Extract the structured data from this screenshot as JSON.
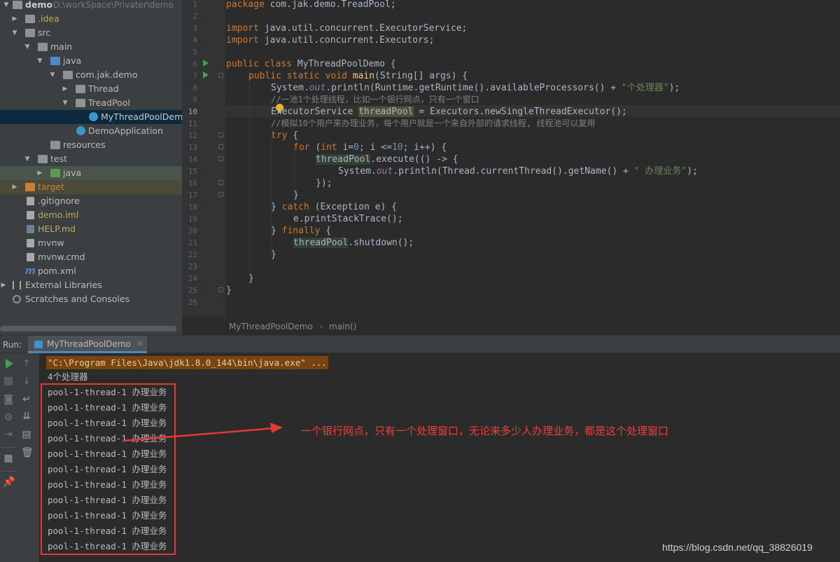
{
  "project_tree": {
    "root": {
      "name": "demo",
      "path": "D:\\workSpace\\Privater\\demo"
    },
    "items": [
      {
        "label": ".idea"
      },
      {
        "label": "src"
      },
      {
        "label": "main"
      },
      {
        "label": "java"
      },
      {
        "label": "com.jak.demo"
      },
      {
        "label": "Thread"
      },
      {
        "label": "TreadPool"
      },
      {
        "label": "MyThreadPoolDemo"
      },
      {
        "label": "DemoApplication"
      },
      {
        "label": "resources"
      },
      {
        "label": "test"
      },
      {
        "label": "java"
      },
      {
        "label": "target"
      },
      {
        "label": ".gitignore"
      },
      {
        "label": "demo.iml"
      },
      {
        "label": "HELP.md"
      },
      {
        "label": "mvnw"
      },
      {
        "label": "mvnw.cmd"
      },
      {
        "label": "pom.xml"
      },
      {
        "label": "External Libraries"
      },
      {
        "label": "Scratches and Consoles"
      }
    ]
  },
  "editor": {
    "line_numbers": [
      "1",
      "2",
      "3",
      "4",
      "5",
      "6",
      "7",
      "8",
      "9",
      "10",
      "11",
      "12",
      "13",
      "14",
      "15",
      "16",
      "17",
      "18",
      "19",
      "20",
      "21",
      "22",
      "23",
      "24",
      "25",
      "26"
    ],
    "code": {
      "l1_kw": "package ",
      "l1_rest": "com.jak.demo.TreadPool;",
      "l3_kw": "import ",
      "l3_rest": "java.util.concurrent.ExecutorService;",
      "l4_kw": "import ",
      "l4_rest": "java.util.concurrent.Executors;",
      "l6_kw": "public class ",
      "l6_name": "MyThreadPoolDemo",
      "l6_rest": " {",
      "l7_kw": "public static void ",
      "l7_fn": "main",
      "l7_rest": "(String[] args) {",
      "l8_a": "System.",
      "l8_out": "out",
      "l8_b": ".println(Runtime.getRuntime().availableProcessors() + ",
      "l8_str": "\"个处理器\"",
      "l8_c": ");",
      "l9": "//一池1个处理线程，比如一个银行网点，只有一个窗口",
      "l10_a": "ExecutorService ",
      "l10_var": "threadPool",
      "l10_b": " = Executors.newSingleThreadExecutor();",
      "l11": "//模拟10个用户来办理业务，每个用户就是一个来自外部的请求线程, 线程池可以复用",
      "l12_kw": "try",
      "l12_rest": " {",
      "l13_kw": "for ",
      "l13_a": "(",
      "l13_kw2": "int ",
      "l13_b": "i=",
      "l13_n1": "0",
      "l13_c": "; i <=",
      "l13_n2": "10",
      "l13_d": "; i++) {",
      "l14_var": "threadPool",
      "l14_rest": ".execute(() -> {",
      "l15_a": "System.",
      "l15_out": "out",
      "l15_b": ".println(Thread.currentThread().getName() + ",
      "l15_str": "\" 办理业务\"",
      "l15_c": ");",
      "l16": "});",
      "l17": "}",
      "l18_a": "} ",
      "l18_kw": "catch",
      "l18_b": " (Exception e) {",
      "l19": "e.printStackTrace();",
      "l20_a": "} ",
      "l20_kw": "finally",
      "l20_b": " {",
      "l21_var": "threadPool",
      "l21_rest": ".shutdown();",
      "l22": "}",
      "l24": "}",
      "l25": "}"
    },
    "breadcrumb": [
      "MyThreadPoolDemo",
      "main()"
    ]
  },
  "run_panel": {
    "label": "Run:",
    "tab_label": "MyThreadPoolDemo",
    "command": "\"C:\\Program Files\\Java\\jdk1.8.0_144\\bin\\java.exe\" ...",
    "output": [
      "4个处理器",
      "pool-1-thread-1 办理业务",
      "pool-1-thread-1 办理业务",
      "pool-1-thread-1 办理业务",
      "pool-1-thread-1 办理业务",
      "pool-1-thread-1 办理业务",
      "pool-1-thread-1 办理业务",
      "pool-1-thread-1 办理业务",
      "pool-1-thread-1 办理业务",
      "pool-1-thread-1 办理业务",
      "pool-1-thread-1 办理业务",
      "pool-1-thread-1 办理业务"
    ]
  },
  "annotation": "一个银行网点，只有一个处理窗口，无论来多少人办理业务，都是这个处理窗口",
  "watermark": "https://blog.csdn.net/qq_38826019",
  "colors": {
    "annotation_red": "#e53935",
    "keyword": "#cc7832",
    "string": "#6a8759",
    "number": "#6897bb",
    "comment": "#808080"
  }
}
